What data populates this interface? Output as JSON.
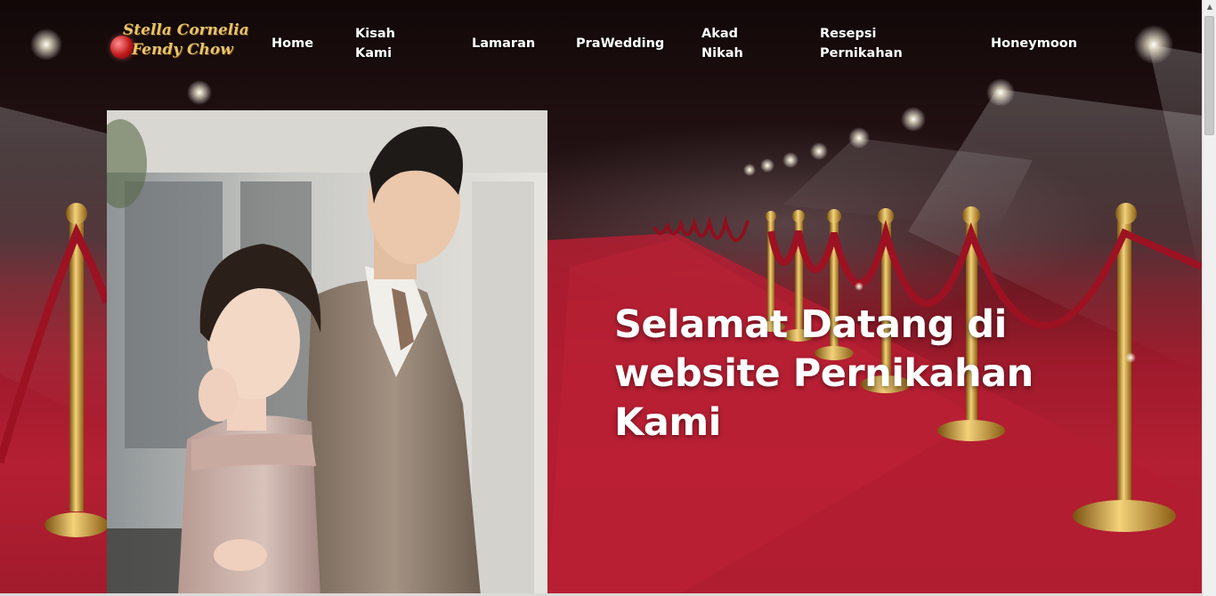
{
  "logo": {
    "line1": "Stella Cornelia",
    "line2": "Fendy Chow"
  },
  "nav": {
    "items": [
      {
        "label": "Home"
      },
      {
        "label": "Kisah\nKami"
      },
      {
        "label": "Lamaran"
      },
      {
        "label": "PraWedding"
      },
      {
        "label": "Akad\nNikah"
      },
      {
        "label": "Resepsi\nPernikahan"
      },
      {
        "label": "Honeymoon"
      }
    ]
  },
  "hero": {
    "heading": "Selamat Datang di website Pernikahan Kami"
  },
  "colors": {
    "carpet_red": "#b51f33",
    "gold": "#d4a63a",
    "nav_text": "#ffffff"
  },
  "icons": {
    "logo_ball": "red-ball-icon",
    "scroll_up": "scroll-up-arrow-icon"
  }
}
